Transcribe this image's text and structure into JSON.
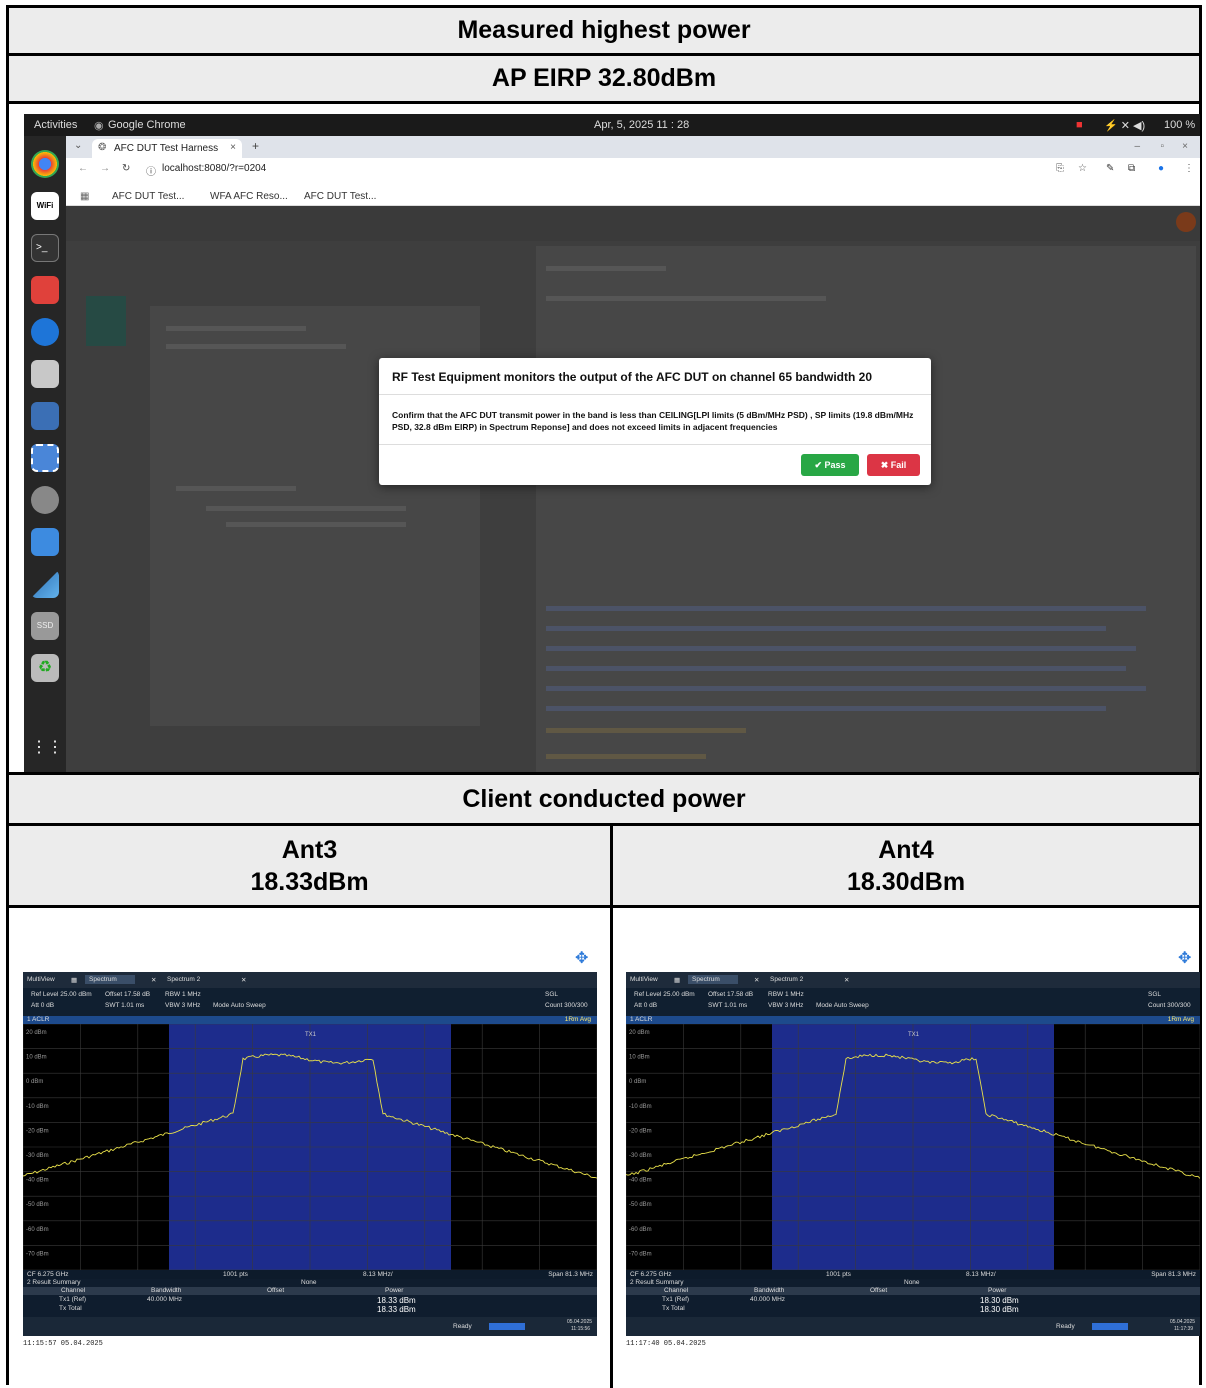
{
  "table": {
    "title": "Measured highest power",
    "subtitle": "AP EIRP 32.80dBm",
    "client_header": "Client conducted power",
    "ant3_name": "Ant3",
    "ant3_value": "18.33dBm",
    "ant4_name": "Ant4",
    "ant4_value": "18.30dBm"
  },
  "desktop": {
    "activities": "Activities",
    "app": "Google Chrome",
    "clock": "Apr, 5, 2025 11 : 28",
    "battery": "100 %"
  },
  "browser": {
    "tab_title": "AFC DUT Test Harness",
    "url": "localhost:8080/?r=0204",
    "bookmarks": [
      "AFC DUT Test...",
      "WFA AFC Reso...",
      "AFC DUT Test..."
    ]
  },
  "dialog": {
    "title": "RF Test Equipment monitors the output of the AFC DUT on channel 65 bandwidth 20",
    "body": "Confirm that the AFC DUT transmit power in the band is less than CEILING[LPI limits (5 dBm/MHz PSD) , SP limits (19.8 dBm/MHz PSD, 32.8 dBm EIRP) in Spectrum Reponse] and does not exceed limits in adjacent frequencies",
    "pass_label": "✔ Pass",
    "fail_label": "✖ Fail"
  },
  "analyzer_common": {
    "tab_multiview": "MultiView",
    "tab_spectrum": "Spectrum",
    "tab_spectrum2": "Spectrum 2",
    "ref_level": "Ref Level 25.00 dBm",
    "offset": "Offset 17.58 dB",
    "rbw": "RBW 1 MHz",
    "att": "Att 0 dB",
    "swt": "SWT 1.01 ms",
    "vbw": "VBW 3 MHz",
    "mode": "Mode Auto Sweep",
    "sgl": "SGL",
    "count": "Count 300/300",
    "aclr": "1 ACLR",
    "rm_avg": "1Rm Avg",
    "tx_label": "TX1",
    "cf": "CF 6.275 GHz",
    "pts": "1001 pts",
    "div": "8.13 MHz/",
    "span": "Span 81.3 MHz",
    "result_summary": "2 Result Summary",
    "none": "None",
    "col_channel": "Channel",
    "col_bandwidth": "Bandwidth",
    "col_offset": "Offset",
    "col_power": "Power",
    "row_ref": "Tx1 (Ref)",
    "row_total": "Tx Total",
    "bandwidth": "40.000 MHz",
    "ready": "Ready",
    "y_ticks": [
      "20 dBm",
      "10 dBm",
      "0 dBm",
      "-10 dBm",
      "-20 dBm",
      "-30 dBm",
      "-40 dBm",
      "-50 dBm",
      "-60 dBm",
      "-70 dBm"
    ]
  },
  "analyzer_ant3": {
    "power": "18.33 dBm",
    "total": "18.33 dBm",
    "date": "05.04.2025",
    "time": "11:15:56",
    "stamp": "11:15:57  05.04.2025"
  },
  "analyzer_ant4": {
    "power": "18.30 dBm",
    "total": "18.30 dBm",
    "date": "05.04.2025",
    "time": "11:17:39",
    "stamp": "11:17:40  05.04.2025"
  },
  "colors": {
    "header_bg": "#ececec",
    "pass": "#28a745",
    "fail": "#dc3545",
    "trace": "#e8e04a",
    "channel_band": "#1d2c8c"
  }
}
